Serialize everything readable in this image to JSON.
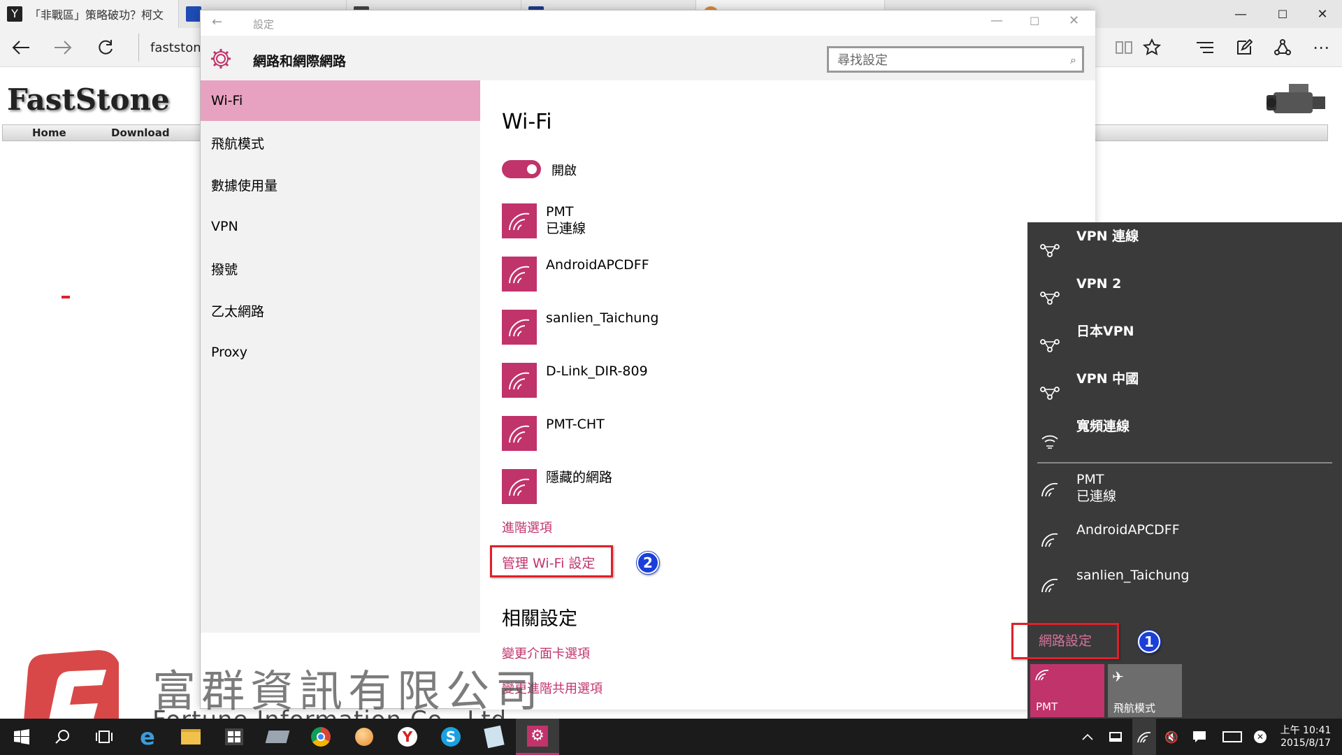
{
  "browser": {
    "tabs": [
      {
        "title": "「非戰區」策略破功？柯文"
      },
      {
        "title": ""
      },
      {
        "title": ""
      },
      {
        "title": ""
      },
      {
        "title": ""
      }
    ],
    "address": "faststone",
    "window_controls": {
      "minimize": "—",
      "maximize": "☐",
      "close": "✕"
    }
  },
  "page": {
    "logo": "FastStone",
    "menu": [
      "Home",
      "Download"
    ]
  },
  "settings": {
    "window_title": "設定",
    "header_title": "網路和網際網路",
    "search_placeholder": "尋找設定",
    "sidebar": [
      {
        "label": "Wi-Fi",
        "selected": true
      },
      {
        "label": "飛航模式"
      },
      {
        "label": "數據使用量"
      },
      {
        "label": "VPN"
      },
      {
        "label": "撥號"
      },
      {
        "label": "乙太網路"
      },
      {
        "label": "Proxy"
      }
    ],
    "page_title": "Wi-Fi",
    "toggle": {
      "label": "開啟",
      "on": true
    },
    "networks": [
      {
        "name": "PMT",
        "status": "已連線"
      },
      {
        "name": "AndroidAPCDFF",
        "status": ""
      },
      {
        "name": "sanlien_Taichung",
        "status": ""
      },
      {
        "name": "D-Link_DIR-809",
        "status": ""
      },
      {
        "name": "PMT-CHT",
        "status": ""
      },
      {
        "name": "隱藏的網路",
        "status": ""
      }
    ],
    "advanced_link": "進階選項",
    "manage_link": "管理 Wi-Fi 設定",
    "related_title": "相關設定",
    "related_links": [
      "變更介面卡選項",
      "變更進階共用選項"
    ]
  },
  "flyout": {
    "vpns": [
      {
        "name": "VPN 連線"
      },
      {
        "name": "VPN 2"
      },
      {
        "name": "日本VPN"
      },
      {
        "name": "VPN 中國"
      },
      {
        "name": "寬頻連線"
      }
    ],
    "wifi": [
      {
        "name": "PMT",
        "status": "已連線"
      },
      {
        "name": "AndroidAPCDFF",
        "status": ""
      },
      {
        "name": "sanlien_Taichung",
        "status": ""
      }
    ],
    "network_settings_link": "網路設定",
    "quick_actions": [
      {
        "label": "PMT",
        "active": true
      },
      {
        "label": "飛航模式",
        "active": false
      }
    ]
  },
  "annotations": {
    "badge1": "1",
    "badge2": "2"
  },
  "taskbar": {
    "time": "上午 10:41",
    "date": "2015/8/17"
  },
  "watermark": {
    "company_cn": "富群資訊有限公司",
    "company_en": "Fortune Information Co., Ltd."
  },
  "colors": {
    "accent": "#c1336b",
    "sidebar_selected": "#e6a2c0",
    "flyout_bg": "#3a3a3a",
    "taskbar_bg": "#1b1b1b",
    "annotation_red": "#e0202a",
    "badge_blue": "#1b3fd8"
  }
}
